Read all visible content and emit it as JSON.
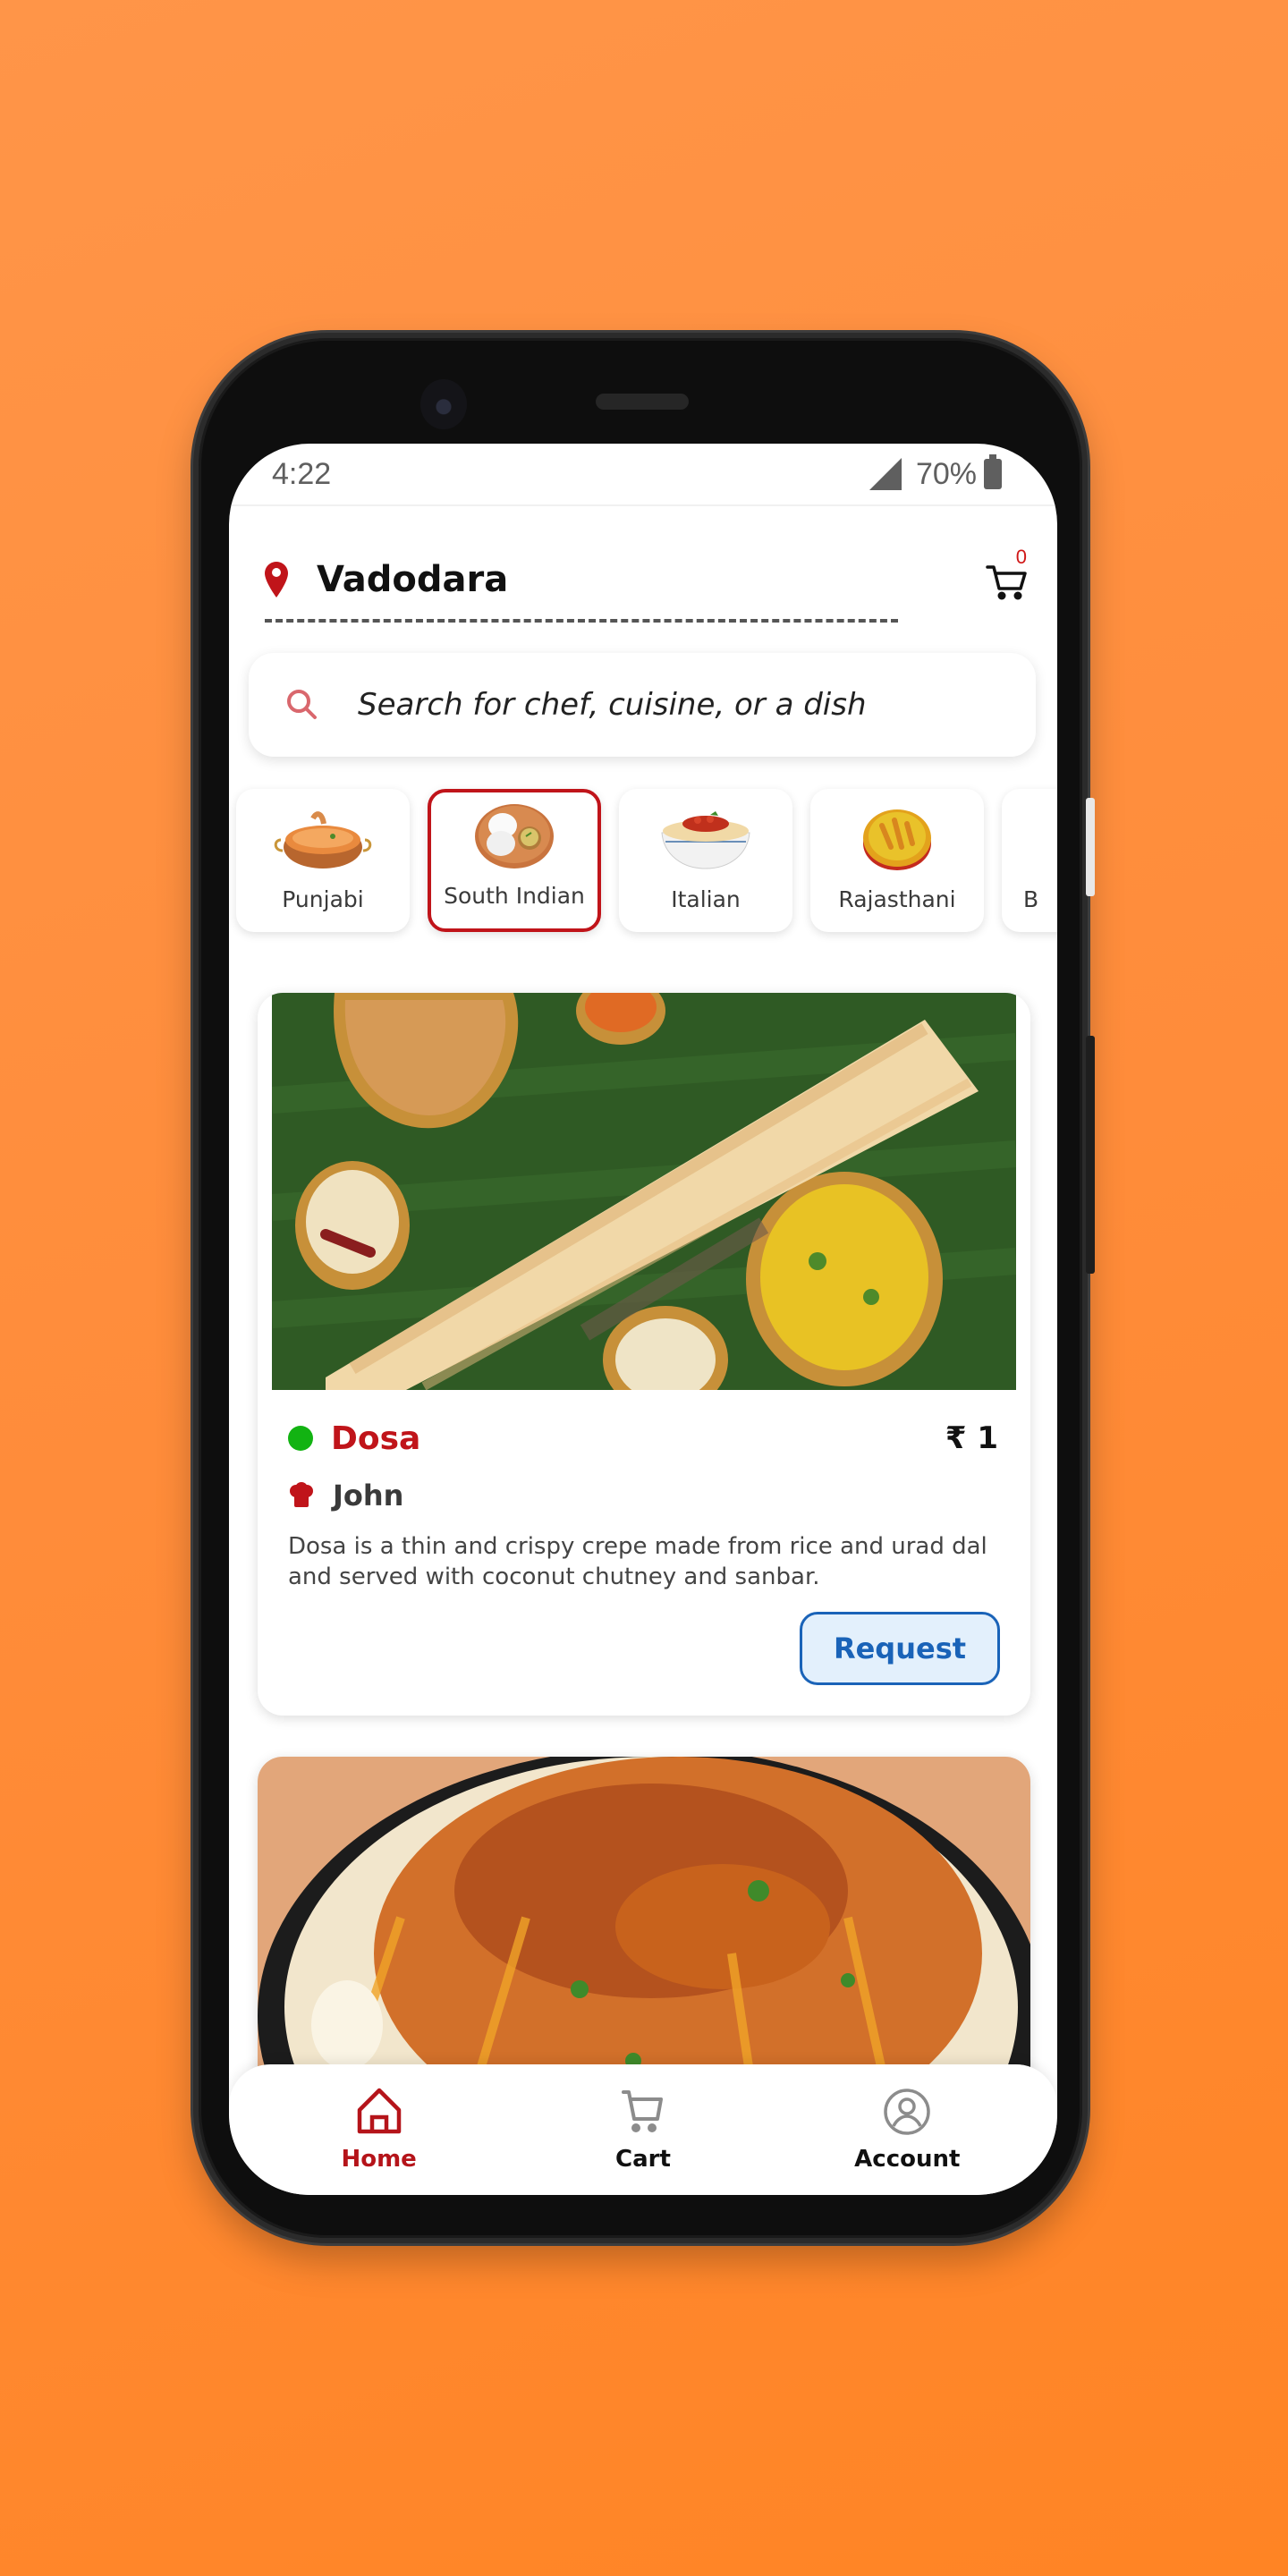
{
  "status_bar": {
    "time": "4:22",
    "battery": "70%"
  },
  "header": {
    "location": "Vadodara",
    "cart_count": "0"
  },
  "search": {
    "placeholder": "Search for chef, cuisine, or a dish"
  },
  "cuisines": [
    {
      "label": "Punjabi",
      "icon": "punjabi-curry-icon",
      "selected": false
    },
    {
      "label": "South Indian",
      "icon": "idli-plate-icon",
      "selected": true
    },
    {
      "label": "Italian",
      "icon": "pasta-bowl-icon",
      "selected": false
    },
    {
      "label": "Rajasthani",
      "icon": "rajasthani-dish-icon",
      "selected": false
    },
    {
      "label": "B",
      "icon": "cuisine-icon",
      "selected": false
    }
  ],
  "dishes": [
    {
      "name": "Dosa",
      "price": "₹ 1",
      "veg": true,
      "chef": "John",
      "description": "Dosa is a thin and crispy crepe made from rice and urad dal and served with coconut chutney and sanbar.",
      "action_label": "Request",
      "image": "dosa-photo"
    },
    {
      "image": "biryani-photo"
    }
  ],
  "bottom_nav": [
    {
      "label": "Home",
      "icon": "home-icon",
      "active": true
    },
    {
      "label": "Cart",
      "icon": "cart-icon",
      "active": false
    },
    {
      "label": "Account",
      "icon": "account-icon",
      "active": false
    }
  ],
  "colors": {
    "brand_red": "#c0141a",
    "veg_green": "#12b312",
    "request_blue": "#1a63b8",
    "background_orange": "#ff8c3a"
  }
}
